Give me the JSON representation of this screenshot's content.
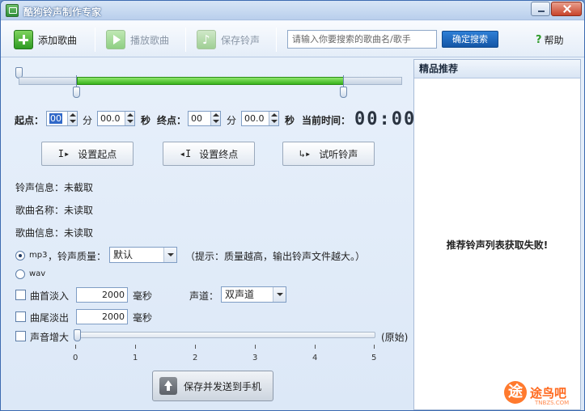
{
  "window": {
    "title": "酷狗铃声制作专家"
  },
  "toolbar": {
    "add_song": "添加歌曲",
    "play_song": "播放歌曲",
    "save_ringtone": "保存铃声",
    "search_placeholder": "请输入你要搜索的歌曲名/歌手",
    "search_button": "确定搜索",
    "help": "帮助"
  },
  "time": {
    "start_label": "起点：",
    "start_min": "00",
    "min_unit": "分",
    "start_sec": "00.0",
    "sec_unit": "秒",
    "end_label": "终点：",
    "end_min": "00",
    "end_sec": "00.0",
    "current_label": "当前时间：",
    "current_time": "00:00"
  },
  "actions": {
    "set_start": "设置起点",
    "set_end": "设置终点",
    "preview": "试听铃声"
  },
  "info": {
    "ringtone": "铃声信息：未截取",
    "song_name": "歌曲名称：未读取",
    "song_info": "歌曲信息：未读取"
  },
  "format": {
    "mp3": "mp3",
    "quality_label": "，铃声质量：",
    "quality_value": "默认",
    "hint": "（提示：质量越高，输出铃声文件越大。）",
    "wav": "wav"
  },
  "effects": {
    "fade_in": "曲首淡入",
    "fade_in_value": "2000",
    "fade_out": "曲尾淡出",
    "fade_out_value": "2000",
    "ms": "毫秒",
    "channel_label": "声道：",
    "channel_value": "双声道",
    "volume_boost": "声音增大",
    "volume_original": "(原始)",
    "volume_level": 0,
    "ticks": [
      "0",
      "1",
      "2",
      "3",
      "4",
      "5"
    ]
  },
  "save_send": "保存并发送到手机",
  "right_panel": {
    "header": "精品推荐",
    "message": "推荐铃声列表获取失败!"
  },
  "watermark": {
    "text": "途鸟吧",
    "sub": "TNBZS.COM"
  }
}
